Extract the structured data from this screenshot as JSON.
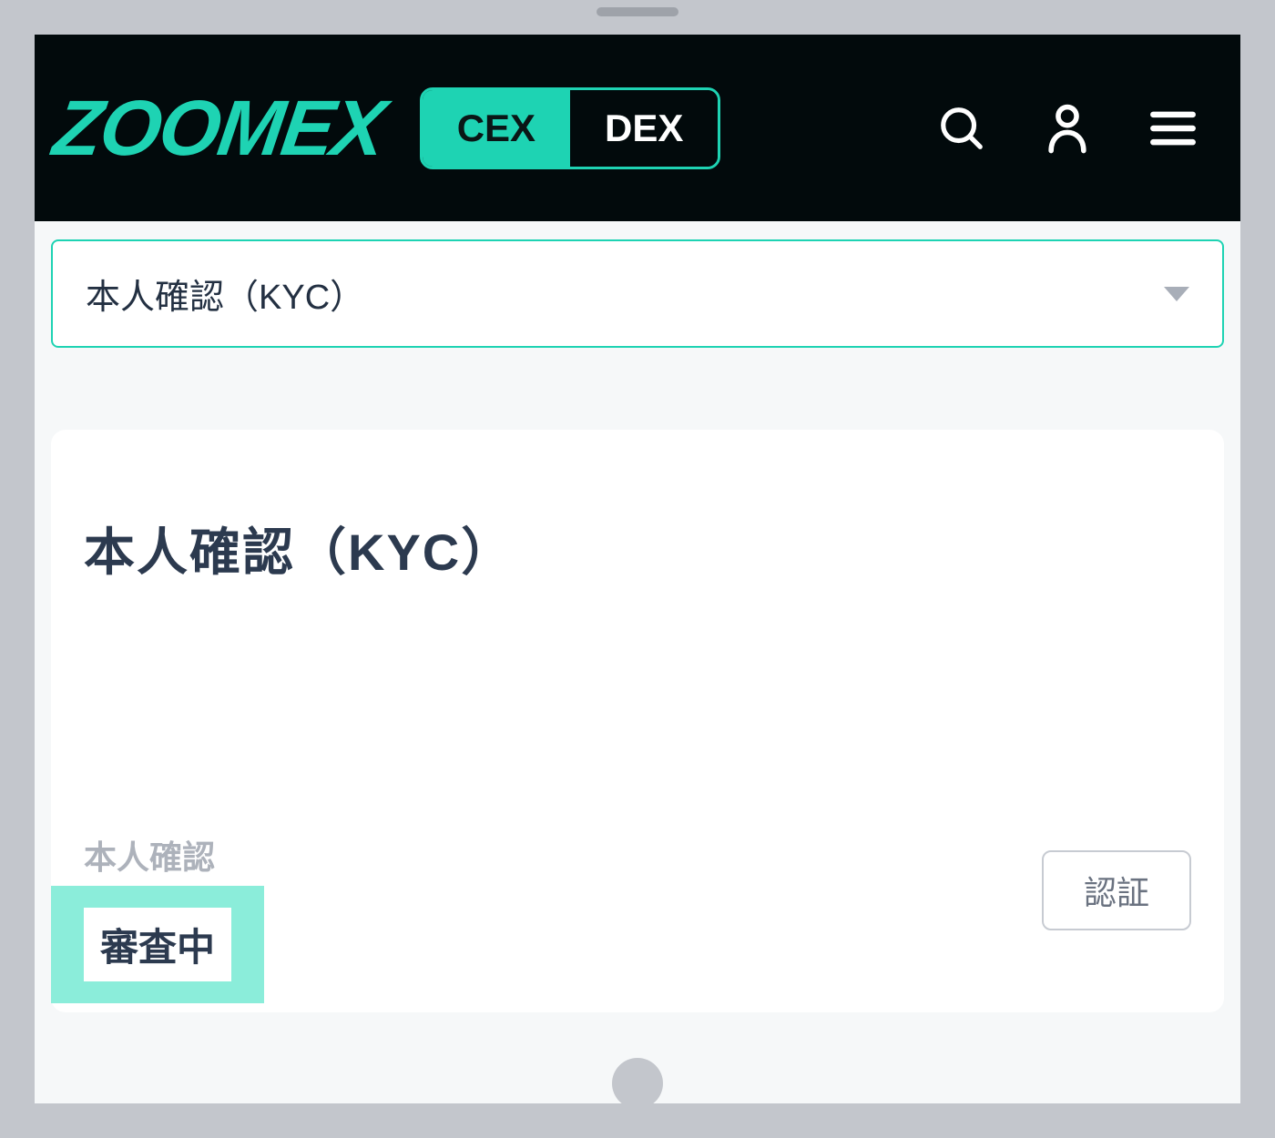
{
  "header": {
    "logo": "ZOOMEX",
    "toggle": {
      "cex": "CEX",
      "dex": "DEX"
    }
  },
  "dropdown": {
    "label": "本人確認（KYC）"
  },
  "card": {
    "title": "本人確認（KYC）",
    "status_label": "本人確認",
    "status_value": "審査中",
    "verify_button": "認証"
  }
}
